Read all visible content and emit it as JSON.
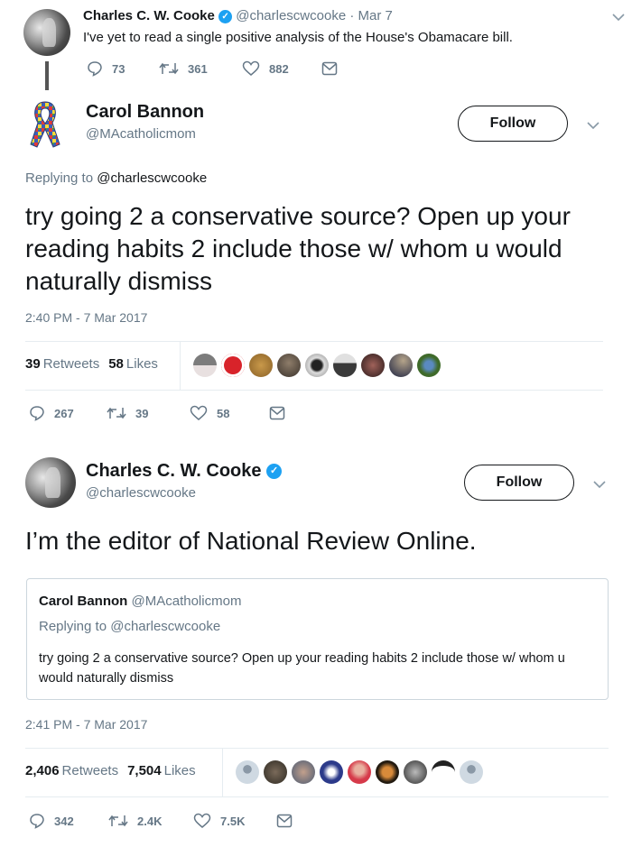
{
  "parent_tweet": {
    "name": "Charles C. W. Cooke",
    "verified": true,
    "handle": "@charlescwcooke",
    "separator": "·",
    "date": "Mar 7",
    "text": "I've yet to read a single positive analysis of the House's Obamacare bill.",
    "actions": {
      "replies": "73",
      "retweets": "361",
      "likes": "882"
    }
  },
  "reply_tweet": {
    "name": "Carol Bannon",
    "handle": "@MAcatholicmom",
    "follow_label": "Follow",
    "replying_prefix": "Replying to",
    "replying_to": "@charlescwcooke",
    "text": "try going 2 a conservative source? Open up your reading habits 2 include those w/ whom u would naturally dismiss",
    "timestamp": "2:40 PM - 7 Mar 2017",
    "stats": {
      "retweets_count": "39",
      "retweets_label": "Retweets",
      "likes_count": "58",
      "likes_label": "Likes"
    },
    "liker_avatars": [
      "photo-person-sign",
      "red-elephant-logo",
      "golden-circle",
      "bearded-man",
      "man-in-frame",
      "man-in-suit",
      "dark-portrait",
      "night-sky",
      "man-outdoors"
    ],
    "actions": {
      "replies": "267",
      "retweets": "39",
      "likes": "58"
    }
  },
  "response_tweet": {
    "name": "Charles C. W. Cooke",
    "verified": true,
    "handle": "@charlescwcooke",
    "follow_label": "Follow",
    "text": "I’m the editor of National Review Online.",
    "quoted": {
      "name": "Carol Bannon",
      "handle": "@MAcatholicmom",
      "replying_prefix": "Replying to",
      "replying_to": "@charlescwcooke",
      "text": "try going 2 a conservative source? Open up your reading habits 2 include those w/ whom u would naturally dismiss"
    },
    "timestamp": "2:41 PM - 7 Mar 2017",
    "stats": {
      "retweets_count": "2,406",
      "retweets_label": "Retweets",
      "likes_count": "7,504",
      "likes_label": "Likes"
    },
    "liker_avatars": [
      "default-avatar",
      "man-glasses",
      "bald-man",
      "cartoon-face",
      "woman-red",
      "woman-orange",
      "bw-portrait",
      "cup-cartoon",
      "default-avatar"
    ],
    "actions": {
      "replies": "342",
      "retweets": "2.4K",
      "likes": "7.5K"
    }
  },
  "colors": {
    "verified_blue": "#1da1f2",
    "secondary_text": "#657786",
    "primary_text": "#14171a",
    "divider": "#e6ecf0"
  }
}
